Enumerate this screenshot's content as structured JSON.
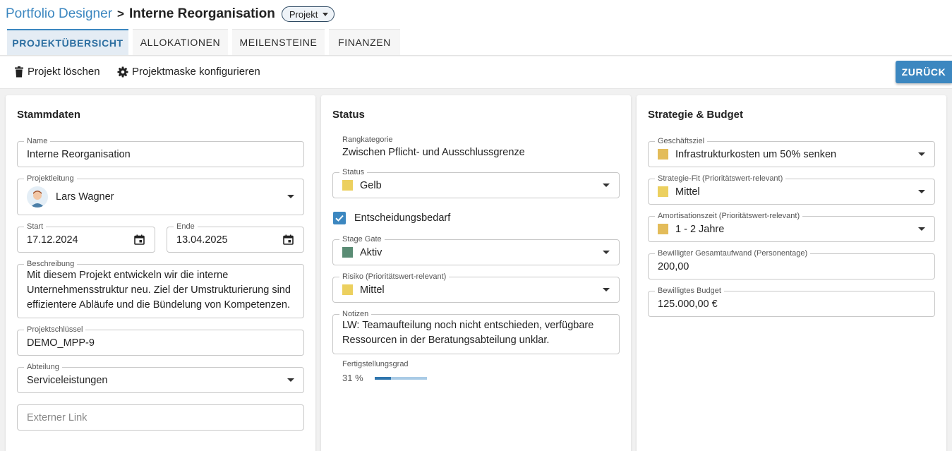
{
  "breadcrumb": {
    "root": "Portfolio Designer",
    "separator": ">",
    "title": "Interne Reorganisation",
    "type_pill": "Projekt"
  },
  "tabs": [
    {
      "label": "PROJEKTÜBERSICHT",
      "active": true
    },
    {
      "label": "ALLOKATIONEN",
      "active": false
    },
    {
      "label": "MEILENSTEINE",
      "active": false
    },
    {
      "label": "FINANZEN",
      "active": false
    }
  ],
  "toolbar": {
    "delete_label": "Projekt löschen",
    "configure_label": "Projektmaske konfigurieren",
    "back_label": "ZURÜCK"
  },
  "stammdaten": {
    "title": "Stammdaten",
    "name": {
      "label": "Name",
      "value": "Interne Reorganisation"
    },
    "projektleitung": {
      "label": "Projektleitung",
      "value": "Lars Wagner"
    },
    "start": {
      "label": "Start",
      "value": "17.12.2024"
    },
    "ende": {
      "label": "Ende",
      "value": "13.04.2025"
    },
    "beschreibung": {
      "label": "Beschreibung",
      "value": "Mit diesem Projekt entwickeln wir die interne Unternehmensstruktur neu. Ziel der Umstrukturierung sind effizientere Abläufe und die Bündelung von Kompetenzen."
    },
    "projektschluessel": {
      "label": "Projektschlüssel",
      "value": "DEMO_MPP-9"
    },
    "abteilung": {
      "label": "Abteilung",
      "value": "Serviceleistungen"
    },
    "externer_link": {
      "placeholder": "Externer Link"
    }
  },
  "status": {
    "title": "Status",
    "rangkategorie": {
      "label": "Rangkategorie",
      "value": "Zwischen Pflicht- und Ausschlussgrenze"
    },
    "status": {
      "label": "Status",
      "value": "Gelb",
      "color": "#ecd05f"
    },
    "entscheidungsbedarf": {
      "label": "Entscheidungsbedarf",
      "checked": true
    },
    "stage_gate": {
      "label": "Stage Gate",
      "value": "Aktiv",
      "color": "#5a8c74"
    },
    "risiko": {
      "label": "Risiko (Prioritätswert-relevant)",
      "value": "Mittel",
      "color": "#ecd05f"
    },
    "notizen": {
      "label": "Notizen",
      "value": "LW: Teamaufteilung noch nicht entschieden, verfügbare Ressourcen in der Beratungsabteilung unklar."
    },
    "fertigstellungsgrad": {
      "label": "Fertigstellungsgrad",
      "value_text": "31 %",
      "fraction": 0.31
    }
  },
  "strategie": {
    "title": "Strategie & Budget",
    "geschaeftsziel": {
      "label": "Geschäftsziel",
      "value": "Infrastrukturkosten um 50% senken",
      "color": "#e3bc5a"
    },
    "strategie_fit": {
      "label": "Strategie-Fit (Prioritätswert-relevant)",
      "value": "Mittel",
      "color": "#ecd05f"
    },
    "amortisationszeit": {
      "label": "Amortisationszeit (Prioritätswert-relevant)",
      "value": "1 - 2 Jahre",
      "color": "#e3bc5a"
    },
    "gesamtaufwand": {
      "label": "Bewilligter Gesamtaufwand (Personentage)",
      "value": "200,00"
    },
    "budget": {
      "label": "Bewilligtes Budget",
      "value": "125.000,00 €"
    }
  },
  "icons": {
    "trash": "trash-icon",
    "gear": "gear-icon",
    "calendar": "calendar-icon",
    "dropdown": "chevron-down-icon",
    "check": "check-icon",
    "avatar": "avatar-icon"
  }
}
